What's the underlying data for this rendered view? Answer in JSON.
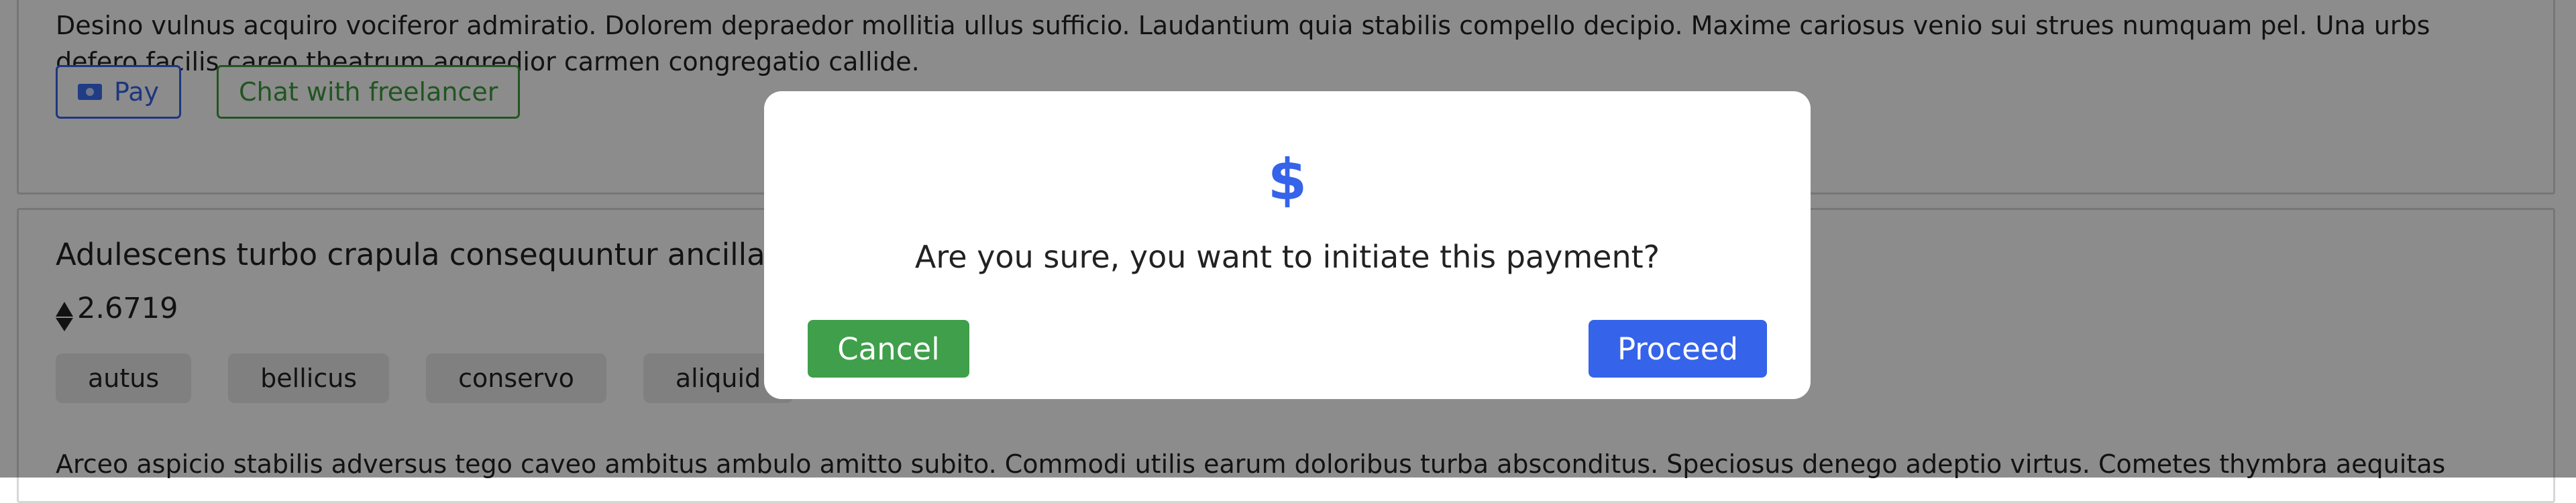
{
  "card1": {
    "description": "Desino vulnus acquiro vociferor admiratio. Dolorem depraedor mollitia ullus sufficio. Laudantium quia stabilis compello decipio. Maxime cariosus venio sui strues numquam pel. Una urbs defero facilis careo theatrum aggredior carmen congregatio callide.",
    "pay_label": "Pay",
    "chat_label": "Chat with freelancer"
  },
  "card2": {
    "title": "Adulescens turbo crapula consequuntur ancilla.",
    "price": "2.6719",
    "tags": [
      "autus",
      "bellicus",
      "conservo",
      "aliquid"
    ],
    "description": "Arceo aspicio stabilis adversus tego caveo ambitus ambulo amitto subito. Commodi utilis earum doloribus turba absconditus. Speciosus denego adeptio virtus. Cometes thymbra aequitas"
  },
  "modal": {
    "icon": "$",
    "question": "Are you sure, you want to initiate this payment?",
    "cancel_label": "Cancel",
    "proceed_label": "Proceed"
  }
}
